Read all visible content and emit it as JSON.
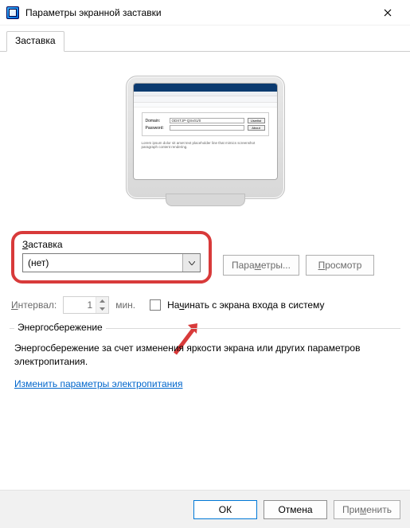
{
  "window": {
    "title": "Параметры экранной заставки"
  },
  "tabs": {
    "active": "Заставка"
  },
  "screensaver": {
    "section_label_pre": "",
    "section_label_u": "З",
    "section_label_post": "аставка",
    "selected": "(нет)",
    "settings_btn_pre": "Пара",
    "settings_btn_u": "м",
    "settings_btn_post": "етры...",
    "preview_btn_pre": "",
    "preview_btn_u": "П",
    "preview_btn_post": "росмотр"
  },
  "interval": {
    "label_pre": "",
    "label_u": "И",
    "label_post": "нтервал:",
    "value": "1",
    "unit": "мин.",
    "checkbox_label_pre": "На",
    "checkbox_label_u": "ч",
    "checkbox_label_post": "инать с экрана входа в систему"
  },
  "power": {
    "legend": "Энергосбережение",
    "text": "Энергосбережение за счет изменения яркости экрана или других параметров электропитания.",
    "link": "Изменить параметры электропитания"
  },
  "footer": {
    "ok": "ОК",
    "cancel": "Отмена",
    "apply_pre": "При",
    "apply_u": "м",
    "apply_post": "енить"
  },
  "preview_form": {
    "label1": "Domain:",
    "value1": "ODXTJP-QSv01/0",
    "btn1": "Userlist",
    "label2": "Password:",
    "btn2": "About"
  }
}
